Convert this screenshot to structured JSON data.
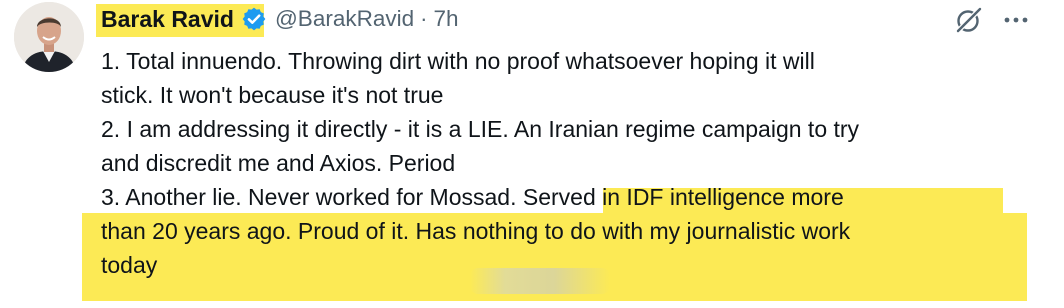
{
  "tweet": {
    "author_name": "Barak Ravid",
    "handle": "@BarakRavid",
    "separator": "·",
    "time": "7h",
    "verified": true,
    "lines": [
      "1. Total innuendo. Throwing dirt with no proof whatsoever hoping it will",
      "stick. It won't because it's not true",
      "2. I am addressing it directly - it is a LIE. An Iranian regime campaign to try",
      "and discredit me and Axios. Period",
      "3. Another lie. Never worked for Mossad. ",
      "Served in IDF intelligence more",
      "than 20 years ago. Proud of it. Has nothing to do with my journalistic work",
      "today"
    ]
  },
  "icons": {
    "verified_badge": "verified-checkmark-icon",
    "grok": "grok-icon",
    "more": "more-options-icon"
  },
  "colors": {
    "highlight": "#fcea55",
    "verified_blue": "#1d9bf0",
    "secondary_text": "#536471",
    "primary_text": "#0f1419"
  }
}
